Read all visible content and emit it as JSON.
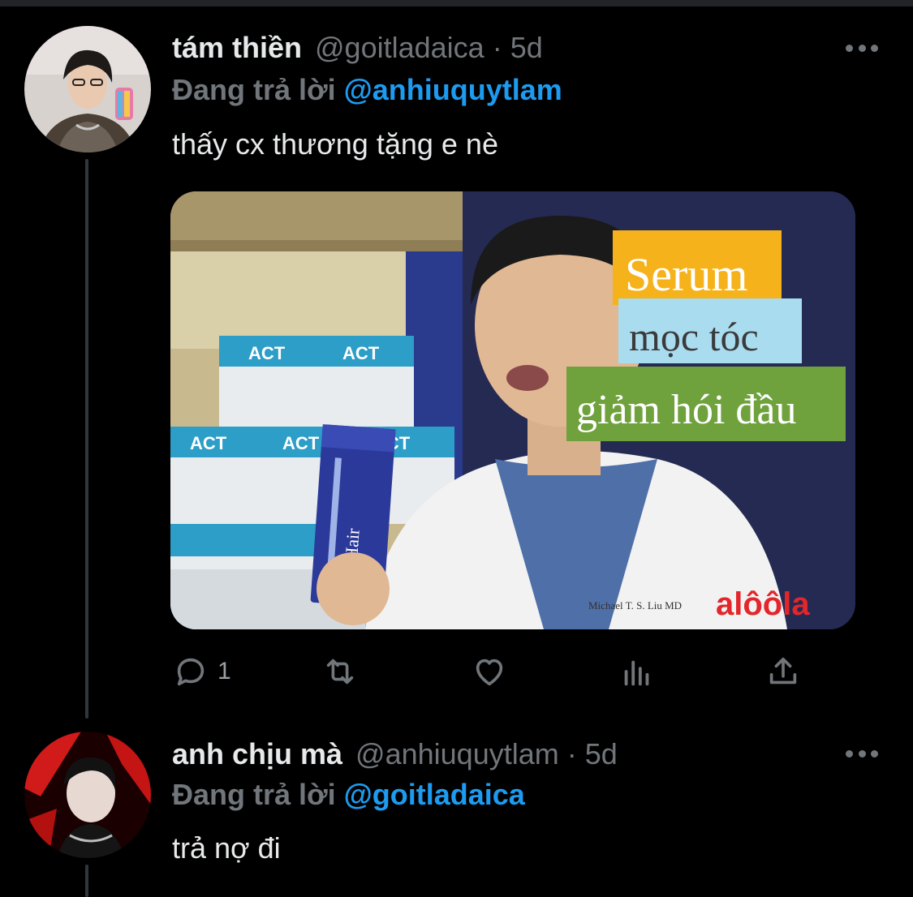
{
  "tweets": [
    {
      "display_name": "tám thiền",
      "handle": "@goitladaica",
      "separator": "·",
      "time": "5d",
      "reply_prefix": "Đang trả lời",
      "reply_to": "@anhiuquytlam",
      "text": "thấy cx thương tặng e nè",
      "media": {
        "overlay_line1": "Serum",
        "overlay_line2": "mọc tóc",
        "overlay_line3": "giảm hói đầu",
        "brand": "alôôla",
        "box_label": "ACT",
        "product_label": "Hair",
        "coat_name": "Michael T. S. Liu MD",
        "colors": {
          "label1_bg": "#f5b21b",
          "label2_bg": "#a9dcef",
          "label3_bg": "#6fa23d",
          "brand": "#e3262b"
        }
      },
      "actions": {
        "reply_count": "1",
        "reply_icon": "reply-bubble-icon",
        "retweet_icon": "retweet-icon",
        "like_icon": "heart-icon",
        "views_icon": "bar-chart-icon",
        "share_icon": "share-upload-icon"
      }
    },
    {
      "display_name": "anh chịu mà",
      "handle": "@anhiuquytlam",
      "separator": "·",
      "time": "5d",
      "reply_prefix": "Đang trả lời",
      "reply_to": "@goitladaica",
      "text": "trả nợ đi"
    }
  ],
  "colors": {
    "background": "#000000",
    "primary_text": "#e7e9ea",
    "secondary_text": "#71767b",
    "link": "#1d9bf0"
  }
}
